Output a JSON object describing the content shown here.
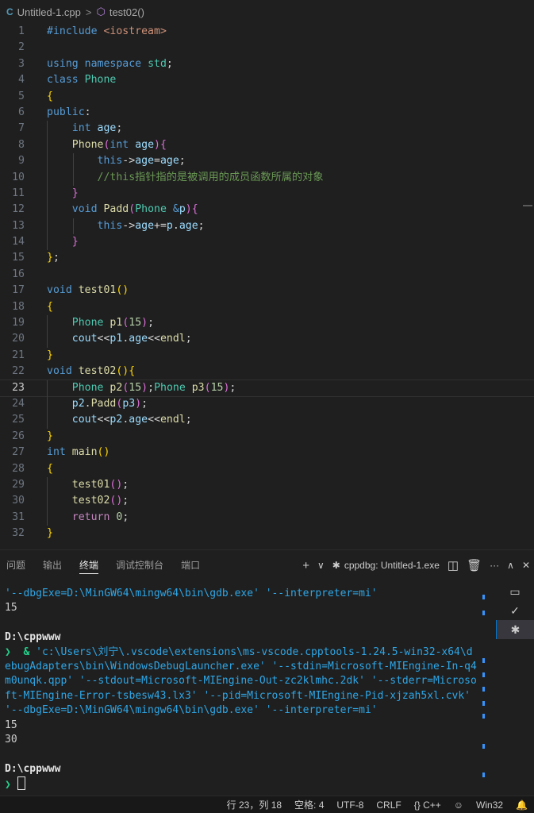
{
  "breadcrumb": {
    "file_icon": "C",
    "file": "Untitled-1.cpp",
    "separator": ">",
    "symbol_icon": "cube-icon",
    "symbol": "test02()"
  },
  "editor": {
    "current_line": 23,
    "lines": [
      {
        "n": "1",
        "indent": 0,
        "tokens": [
          [
            "kw",
            "#include"
          ],
          [
            "op",
            " "
          ],
          [
            "str",
            "<iostream>"
          ]
        ]
      },
      {
        "n": "2",
        "indent": 0,
        "tokens": []
      },
      {
        "n": "3",
        "indent": 0,
        "tokens": [
          [
            "kw",
            "using"
          ],
          [
            "op",
            " "
          ],
          [
            "kw",
            "namespace"
          ],
          [
            "op",
            " "
          ],
          [
            "type",
            "std"
          ],
          [
            "op",
            ";"
          ]
        ]
      },
      {
        "n": "4",
        "indent": 0,
        "tokens": [
          [
            "kw",
            "class"
          ],
          [
            "op",
            " "
          ],
          [
            "type",
            "Phone"
          ]
        ]
      },
      {
        "n": "5",
        "indent": 0,
        "tokens": [
          [
            "b1",
            "{"
          ]
        ]
      },
      {
        "n": "6",
        "indent": 0,
        "tokens": [
          [
            "kw",
            "public"
          ],
          [
            "op",
            ":"
          ]
        ]
      },
      {
        "n": "7",
        "indent": 1,
        "tokens": [
          [
            "op",
            "    "
          ],
          [
            "kw",
            "int"
          ],
          [
            "op",
            " "
          ],
          [
            "var",
            "age"
          ],
          [
            "op",
            ";"
          ]
        ]
      },
      {
        "n": "8",
        "indent": 1,
        "tokens": [
          [
            "op",
            "    "
          ],
          [
            "fn",
            "Phone"
          ],
          [
            "b2",
            "("
          ],
          [
            "kw",
            "int"
          ],
          [
            "op",
            " "
          ],
          [
            "var",
            "age"
          ],
          [
            "b2",
            ")"
          ],
          [
            "b2",
            "{"
          ]
        ]
      },
      {
        "n": "9",
        "indent": 2,
        "tokens": [
          [
            "op",
            "        "
          ],
          [
            "kw",
            "this"
          ],
          [
            "op",
            "->"
          ],
          [
            "var",
            "age"
          ],
          [
            "op",
            "="
          ],
          [
            "var",
            "age"
          ],
          [
            "op",
            ";"
          ]
        ]
      },
      {
        "n": "10",
        "indent": 2,
        "tokens": [
          [
            "op",
            "        "
          ],
          [
            "com",
            "//this指针指的是被调用的成员函数所属的对象"
          ]
        ]
      },
      {
        "n": "11",
        "indent": 1,
        "tokens": [
          [
            "op",
            "    "
          ],
          [
            "b2",
            "}"
          ]
        ]
      },
      {
        "n": "12",
        "indent": 1,
        "tokens": [
          [
            "op",
            "    "
          ],
          [
            "kw",
            "void"
          ],
          [
            "op",
            " "
          ],
          [
            "fn",
            "Padd"
          ],
          [
            "b2",
            "("
          ],
          [
            "type",
            "Phone"
          ],
          [
            "op",
            " "
          ],
          [
            "kw",
            "&"
          ],
          [
            "var",
            "p"
          ],
          [
            "b2",
            ")"
          ],
          [
            "b2",
            "{"
          ]
        ]
      },
      {
        "n": "13",
        "indent": 2,
        "tokens": [
          [
            "op",
            "        "
          ],
          [
            "kw",
            "this"
          ],
          [
            "op",
            "->"
          ],
          [
            "var",
            "age"
          ],
          [
            "op",
            "+="
          ],
          [
            "var",
            "p"
          ],
          [
            "op",
            "."
          ],
          [
            "var",
            "age"
          ],
          [
            "op",
            ";"
          ]
        ]
      },
      {
        "n": "14",
        "indent": 1,
        "tokens": [
          [
            "op",
            "    "
          ],
          [
            "b2",
            "}"
          ]
        ]
      },
      {
        "n": "15",
        "indent": 0,
        "tokens": [
          [
            "b1",
            "}"
          ],
          [
            "op",
            ";"
          ]
        ]
      },
      {
        "n": "16",
        "indent": 0,
        "tokens": []
      },
      {
        "n": "17",
        "indent": 0,
        "tokens": [
          [
            "kw",
            "void"
          ],
          [
            "op",
            " "
          ],
          [
            "fn",
            "test01"
          ],
          [
            "b1",
            "()"
          ]
        ]
      },
      {
        "n": "18",
        "indent": 0,
        "tokens": [
          [
            "b1",
            "{"
          ]
        ]
      },
      {
        "n": "19",
        "indent": 1,
        "tokens": [
          [
            "op",
            "    "
          ],
          [
            "type",
            "Phone"
          ],
          [
            "op",
            " "
          ],
          [
            "fn",
            "p1"
          ],
          [
            "b2",
            "("
          ],
          [
            "num",
            "15"
          ],
          [
            "b2",
            ")"
          ],
          [
            "op",
            ";"
          ]
        ]
      },
      {
        "n": "20",
        "indent": 1,
        "tokens": [
          [
            "op",
            "    "
          ],
          [
            "var",
            "cout"
          ],
          [
            "op",
            "<<"
          ],
          [
            "var",
            "p1"
          ],
          [
            "op",
            "."
          ],
          [
            "var",
            "age"
          ],
          [
            "op",
            "<<"
          ],
          [
            "fn",
            "endl"
          ],
          [
            "op",
            ";"
          ]
        ]
      },
      {
        "n": "21",
        "indent": 0,
        "tokens": [
          [
            "b1",
            "}"
          ]
        ]
      },
      {
        "n": "22",
        "indent": 0,
        "tokens": [
          [
            "kw",
            "void"
          ],
          [
            "op",
            " "
          ],
          [
            "fn",
            "test02"
          ],
          [
            "b1",
            "()"
          ],
          [
            "b1",
            "{"
          ]
        ]
      },
      {
        "n": "23",
        "indent": 1,
        "tokens": [
          [
            "op",
            "    "
          ],
          [
            "type",
            "Phone"
          ],
          [
            "op",
            " "
          ],
          [
            "fn",
            "p2"
          ],
          [
            "b2",
            "("
          ],
          [
            "num",
            "15"
          ],
          [
            "b2",
            ")"
          ],
          [
            "op",
            ";"
          ],
          [
            "type",
            "Phone"
          ],
          [
            "op",
            " "
          ],
          [
            "fn",
            "p3"
          ],
          [
            "b2",
            "("
          ],
          [
            "num",
            "15"
          ],
          [
            "b2",
            ")"
          ],
          [
            "op",
            ";"
          ]
        ]
      },
      {
        "n": "24",
        "indent": 1,
        "tokens": [
          [
            "op",
            "    "
          ],
          [
            "var",
            "p2"
          ],
          [
            "op",
            "."
          ],
          [
            "fn",
            "Padd"
          ],
          [
            "b2",
            "("
          ],
          [
            "var",
            "p3"
          ],
          [
            "b2",
            ")"
          ],
          [
            "op",
            ";"
          ]
        ]
      },
      {
        "n": "25",
        "indent": 1,
        "tokens": [
          [
            "op",
            "    "
          ],
          [
            "var",
            "cout"
          ],
          [
            "op",
            "<<"
          ],
          [
            "var",
            "p2"
          ],
          [
            "op",
            "."
          ],
          [
            "var",
            "age"
          ],
          [
            "op",
            "<<"
          ],
          [
            "fn",
            "endl"
          ],
          [
            "op",
            ";"
          ]
        ]
      },
      {
        "n": "26",
        "indent": 0,
        "tokens": [
          [
            "b1",
            "}"
          ]
        ]
      },
      {
        "n": "27",
        "indent": 0,
        "tokens": [
          [
            "kw",
            "int"
          ],
          [
            "op",
            " "
          ],
          [
            "fn",
            "main"
          ],
          [
            "b1",
            "()"
          ]
        ]
      },
      {
        "n": "28",
        "indent": 0,
        "tokens": [
          [
            "b1",
            "{"
          ]
        ]
      },
      {
        "n": "29",
        "indent": 1,
        "tokens": [
          [
            "op",
            "    "
          ],
          [
            "fn",
            "test01"
          ],
          [
            "b2",
            "()"
          ],
          [
            "op",
            ";"
          ]
        ]
      },
      {
        "n": "30",
        "indent": 1,
        "tokens": [
          [
            "op",
            "    "
          ],
          [
            "fn",
            "test02"
          ],
          [
            "b2",
            "()"
          ],
          [
            "op",
            ";"
          ]
        ]
      },
      {
        "n": "31",
        "indent": 1,
        "tokens": [
          [
            "op",
            "    "
          ],
          [
            "ctrl",
            "return"
          ],
          [
            "op",
            " "
          ],
          [
            "num",
            "0"
          ],
          [
            "op",
            ";"
          ]
        ]
      },
      {
        "n": "32",
        "indent": 0,
        "tokens": [
          [
            "b1",
            "}"
          ]
        ]
      }
    ]
  },
  "panel": {
    "tabs": [
      {
        "label": "问题",
        "active": false
      },
      {
        "label": "输出",
        "active": false
      },
      {
        "label": "终端",
        "active": true
      },
      {
        "label": "调试控制台",
        "active": false
      },
      {
        "label": "端口",
        "active": false
      }
    ],
    "actions": {
      "add": "+",
      "dropdown": "∨",
      "debug_icon": "bug-icon",
      "terminal_name": "cppdbg: Untitled-1.exe",
      "split": "split-icon",
      "trash": "trash-icon",
      "more": "···",
      "maximize": "∧",
      "close": "✕"
    },
    "terminal_lines": [
      {
        "cls": "t-blue",
        "text": "'--dbgExe=D:\\MinGW64\\mingw64\\bin\\gdb.exe' '--interpreter=mi'"
      },
      {
        "cls": "",
        "text": "15"
      },
      {
        "cls": "",
        "text": ""
      },
      {
        "cls": "t-white",
        "text": "D:\\cppwww"
      },
      {
        "cls": "prompt",
        "prefix": "❯  & ",
        "text": "'c:\\Users\\刘宁\\.vscode\\extensions\\ms-vscode.cpptools-1.24.5-win32-x64\\d"
      },
      {
        "cls": "t-blue",
        "text": "ebugAdapters\\bin\\WindowsDebugLauncher.exe' '--stdin=Microsoft-MIEngine-In-q4"
      },
      {
        "cls": "t-blue",
        "text": "m0unqk.qpp' '--stdout=Microsoft-MIEngine-Out-zc2klmhc.2dk' '--stderr=Microso"
      },
      {
        "cls": "t-blue",
        "text": "ft-MIEngine-Error-tsbesw43.lx3' '--pid=Microsoft-MIEngine-Pid-xjzah5xl.cvk'"
      },
      {
        "cls": "t-blue",
        "text": "'--dbgExe=D:\\MinGW64\\mingw64\\bin\\gdb.exe' '--interpreter=mi'"
      },
      {
        "cls": "",
        "text": "15"
      },
      {
        "cls": "",
        "text": "30"
      },
      {
        "cls": "",
        "text": ""
      },
      {
        "cls": "t-white",
        "text": "D:\\cppwww"
      },
      {
        "cls": "cursor-line",
        "prefix": "❯ ",
        "text": ""
      }
    ],
    "side_items": [
      {
        "name": "terminal-icon",
        "glyph": "▭",
        "active": false
      },
      {
        "name": "check-icon",
        "glyph": "✓",
        "active": false
      },
      {
        "name": "bug-icon",
        "glyph": "✱",
        "active": true
      }
    ]
  },
  "status": {
    "position": "行 23，列 18",
    "spaces": "空格: 4",
    "encoding": "UTF-8",
    "eol": "CRLF",
    "language": "{} C++",
    "copilot_icon": "copilot-icon",
    "platform": "Win32",
    "bell_icon": "bell-icon"
  }
}
